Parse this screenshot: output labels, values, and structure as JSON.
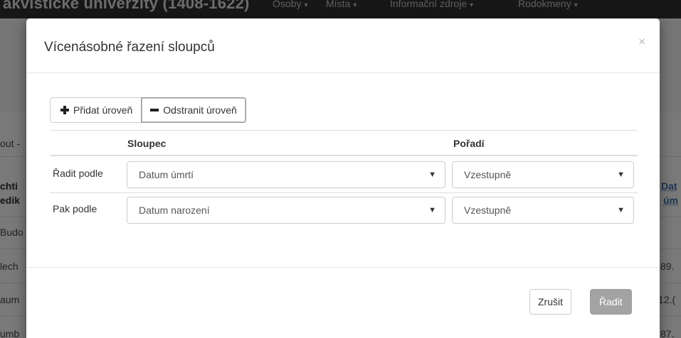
{
  "background": {
    "brand": "akvistické univerzity (1408-1622)",
    "nav": [
      {
        "label": "Osoby"
      },
      {
        "label": "Místa"
      },
      {
        "label": "Informační zdroje"
      },
      {
        "label": "Rodokmeny"
      }
    ],
    "fragments": {
      "left_out": "out -",
      "left_chti": "chti",
      "left_edik": "edik",
      "left_budo": "Budo",
      "left_lech": "lech",
      "left_aum1": "aum",
      "left_aum2": "umb",
      "right_dat": "Dat",
      "right_um": "úm",
      "right_v1": "89.",
      "right_v2": "12.(",
      "right_v3": "87."
    }
  },
  "modal": {
    "title": "Vícenásobné řazení sloupců",
    "close": "×",
    "add_level": "Přidat úroveň",
    "remove_level": "Odstranit úroveň",
    "columns": {
      "column": "Sloupec",
      "order": "Pořadí"
    },
    "rows": [
      {
        "label": "Řadit podle",
        "column": "Datum úmrtí",
        "order": "Vzestupně"
      },
      {
        "label": "Pak podle",
        "column": "Datum narození",
        "order": "Vzestupně"
      }
    ],
    "cancel": "Zrušit",
    "sort": "Řadit",
    "icons": {
      "add": "plus-icon",
      "remove": "minus-icon",
      "select": "caret-down-icon",
      "close": "close-icon"
    }
  }
}
